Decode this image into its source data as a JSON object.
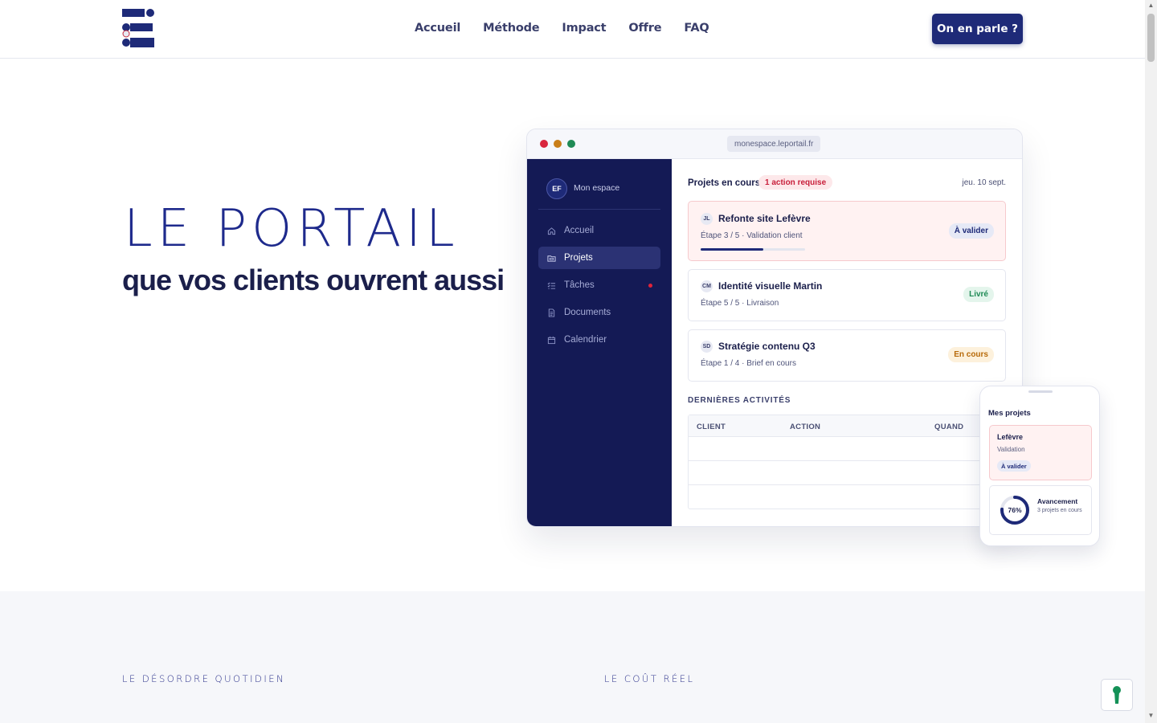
{
  "header": {
    "nav": [
      "Accueil",
      "Méthode",
      "Impact",
      "Offre",
      "FAQ"
    ],
    "cta_label": "On en parle ?"
  },
  "hero": {
    "title": "LE PORTAIL",
    "subtitle": "que vos clients ouvrent aussi"
  },
  "browser": {
    "url": "monespace.leportail.fr",
    "dots": [
      "#d9263d",
      "#c97e18",
      "#1f8a55"
    ],
    "sidebar": {
      "avatar_initials": "EF",
      "space_label": "Mon espace",
      "items": [
        {
          "label": "Accueil",
          "icon": "home-icon"
        },
        {
          "label": "Projets",
          "icon": "folder-icon",
          "active": true
        },
        {
          "label": "Tâches",
          "icon": "checklist-icon",
          "notification": true
        },
        {
          "label": "Documents",
          "icon": "document-icon"
        },
        {
          "label": "Calendrier",
          "icon": "calendar-icon"
        }
      ]
    },
    "main": {
      "title": "Projets en cours",
      "badge": "1 action requise",
      "date": "jeu. 10 sept.",
      "projects": [
        {
          "initials": "JL",
          "title": "Refonte site Lefèvre",
          "step": "Étape 3 / 5 · Validation client",
          "status": "À valider",
          "progress": 0.6
        },
        {
          "initials": "CM",
          "title": "Identité visuelle Martin",
          "step": "Étape 5 / 5 · Livraison",
          "status": "Livré"
        },
        {
          "initials": "SD",
          "title": "Stratégie contenu Q3",
          "step": "Étape 1 / 4 · Brief en cours",
          "status": "En cours"
        }
      ],
      "activities_title": "DERNIÈRES ACTIVITÉS",
      "columns": [
        "CLIENT",
        "ACTION",
        "QUAND"
      ]
    }
  },
  "phone": {
    "title": "Mes projets",
    "card": {
      "title": "Lefèvre",
      "subtitle": "Validation",
      "badge": "À valider"
    },
    "progress": {
      "value": 0.76,
      "label": "76%",
      "title": "Avancement",
      "subtitle": "3 projets en cours"
    }
  },
  "sections": {
    "left_label": "LE DÉSORDRE QUOTIDIEN",
    "right_label": "LE COÛT RÉEL"
  },
  "colors": {
    "brand": "#1e2a78",
    "sidebar": "#141a55",
    "danger": "#c81e3a",
    "success": "#1f8a55",
    "warning": "#b76a0a"
  }
}
